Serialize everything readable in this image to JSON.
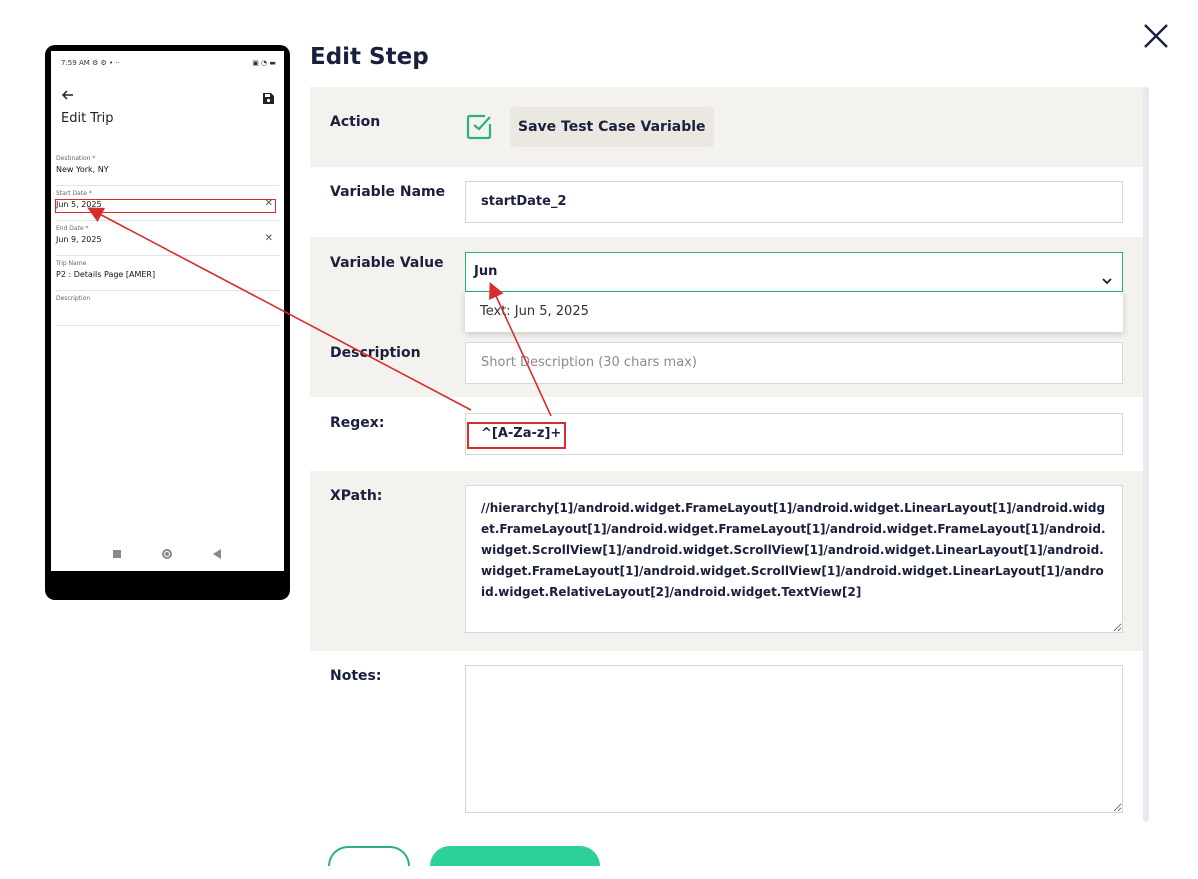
{
  "dialog": {
    "title": "Edit Step"
  },
  "phone": {
    "status_time": "7:59 AM ⚙ ⚙ • ··",
    "status_icons": "▣ ◔ ▬",
    "screen_title": "Edit Trip",
    "fields": [
      {
        "label": "Destination *",
        "value": "New York, NY",
        "clear": ""
      },
      {
        "label": "Start Date *",
        "value": "Jun 5, 2025",
        "clear": "✕"
      },
      {
        "label": "End Date *",
        "value": "Jun 9, 2025",
        "clear": "✕"
      },
      {
        "label": "Trip Name",
        "value": "P2 : Details Page [AMER]",
        "clear": ""
      },
      {
        "label": "Description",
        "value": "",
        "clear": ""
      }
    ]
  },
  "form": {
    "action_label": "Action",
    "action_value": "Save Test Case Variable",
    "variable_name_label": "Variable Name",
    "variable_name_value": "startDate_2",
    "variable_value_label": "Variable Value",
    "variable_value_value": "Jun",
    "dropdown_option": "Text: Jun 5, 2025",
    "description_label": "Description",
    "description_placeholder": "Short Description (30 chars max)",
    "regex_label": "Regex:",
    "regex_value": "^[A-Za-z]+",
    "xpath_label": "XPath:",
    "xpath_value": "//hierarchy[1]/android.widget.FrameLayout[1]/android.widget.LinearLayout[1]/android.widget.FrameLayout[1]/android.widget.FrameLayout[1]/android.widget.FrameLayout[1]/android.widget.ScrollView[1]/android.widget.ScrollView[1]/android.widget.LinearLayout[1]/android.widget.FrameLayout[1]/android.widget.ScrollView[1]/android.widget.LinearLayout[1]/android.widget.RelativeLayout[2]/android.widget.TextView[2]",
    "notes_label": "Notes:",
    "notes_value": ""
  },
  "colors": {
    "accent": "#2bb07f",
    "annotation": "#d62d2d",
    "title": "#1a1f3d"
  },
  "icons": [
    "close-icon",
    "check-icon",
    "chevron-down-icon",
    "back-arrow-icon",
    "save-icon"
  ]
}
